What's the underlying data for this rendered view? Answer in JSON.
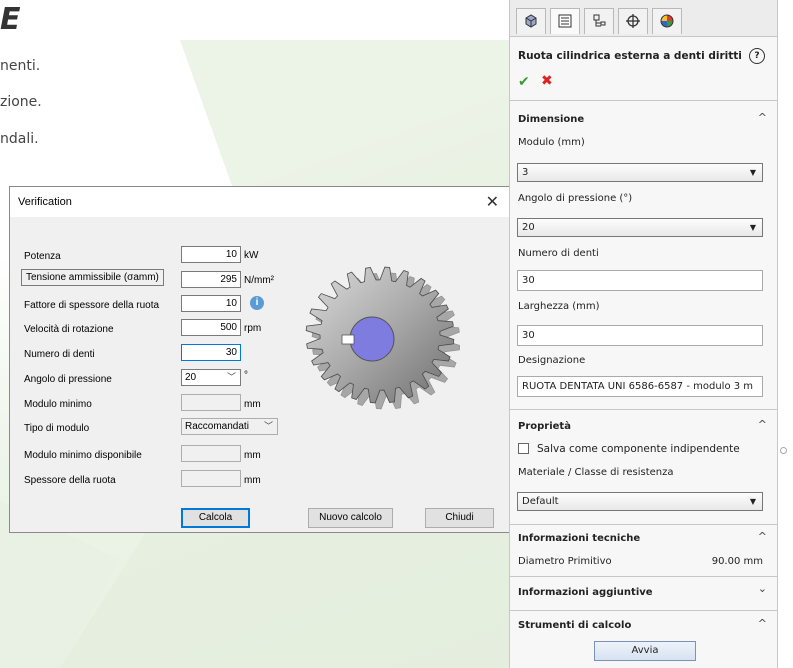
{
  "background": {
    "title_fragment": "E",
    "lines": [
      "nenti.",
      "zione.",
      "ndali."
    ]
  },
  "dialog": {
    "title": "Verification",
    "close_glyph": "✕",
    "rows": {
      "power": {
        "label": "Potenza",
        "value": "10",
        "unit": "kW"
      },
      "stress": {
        "label": "Tensione ammissibile (σamm)",
        "value": "295",
        "unit": "N/mm²"
      },
      "thickness_factor": {
        "label": "Fattore di spessore della ruota",
        "value": "10"
      },
      "speed": {
        "label": "Velocità di rotazione",
        "value": "500",
        "unit": "rpm"
      },
      "teeth": {
        "label": "Numero di denti",
        "value": "30"
      },
      "pressure_angle": {
        "label": "Angolo di pressione",
        "value": "20",
        "unit": "°"
      },
      "min_module": {
        "label": "Modulo minimo",
        "value": "",
        "unit": "mm"
      },
      "module_type": {
        "label": "Tipo di modulo",
        "value": "Raccomandati"
      },
      "min_module_avail": {
        "label": "Modulo minimo disponibile",
        "value": "",
        "unit": "mm"
      },
      "wheel_thickness": {
        "label": "Spessore della ruota",
        "value": "",
        "unit": "mm"
      }
    },
    "buttons": {
      "calculate": "Calcola",
      "new_calc": "Nuovo calcolo",
      "close": "Chiudi"
    }
  },
  "panel": {
    "title": "Ruota cilindrica esterna a denti diritti",
    "help_glyph": "?",
    "ok_glyph": "✔",
    "cancel_glyph": "✖",
    "tabs": [
      "feature-manager-icon",
      "property-manager-icon",
      "configuration-manager-icon",
      "dimxpert-icon",
      "appearance-icon"
    ],
    "dimensione": {
      "title": "Dimensione",
      "module_label": "Modulo (mm)",
      "module_value": "3",
      "angle_label": "Angolo di pressione (°)",
      "angle_value": "20",
      "teeth_label": "Numero di denti",
      "teeth_value": "30",
      "width_label": "Larghezza (mm)",
      "width_value": "30",
      "designation_label": "Designazione",
      "designation_value": "RUOTA DENTATA UNI 6586-6587 - modulo 3 m"
    },
    "proprieta": {
      "title": "Proprietà",
      "save_component_label": "Salva come componente indipendente",
      "save_component_checked": false,
      "material_label": "Materiale / Classe di resistenza",
      "material_value": "Default"
    },
    "info_tecniche": {
      "title": "Informazioni tecniche",
      "pitch_label": "Diametro Primitivo",
      "pitch_value": "90.00 mm"
    },
    "info_aggiuntive": {
      "title": "Informazioni aggiuntive"
    },
    "strumenti": {
      "title": "Strumenti di calcolo",
      "button": "Avvia"
    },
    "chevron_up": "^",
    "chevron_down": "⌄"
  }
}
